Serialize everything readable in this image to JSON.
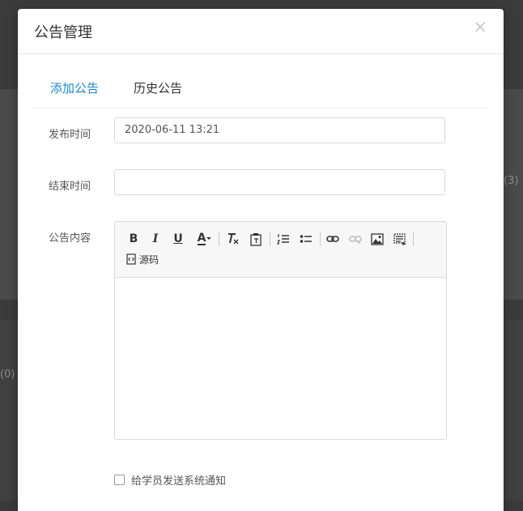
{
  "background": {
    "count_right": "(3)",
    "count_left": "(0)"
  },
  "modal": {
    "title": "公告管理",
    "close_symbol": "×",
    "tabs": [
      {
        "label": "添加公告",
        "active": true
      },
      {
        "label": "历史公告",
        "active": false
      }
    ],
    "form": {
      "publish_time_label": "发布时间",
      "publish_time_value": "2020-06-11 13:21",
      "end_time_label": "结束时间",
      "end_time_value": "",
      "content_label": "公告内容",
      "notify_label": "给学员发送系统通知",
      "notify_checked": false
    },
    "editor": {
      "bold": "B",
      "italic": "I",
      "underline": "U",
      "font_color": "A",
      "source_label": "源码",
      "content": ""
    }
  },
  "colors": {
    "accent": "#1e88c8",
    "backdrop": "#3b3b3b"
  }
}
